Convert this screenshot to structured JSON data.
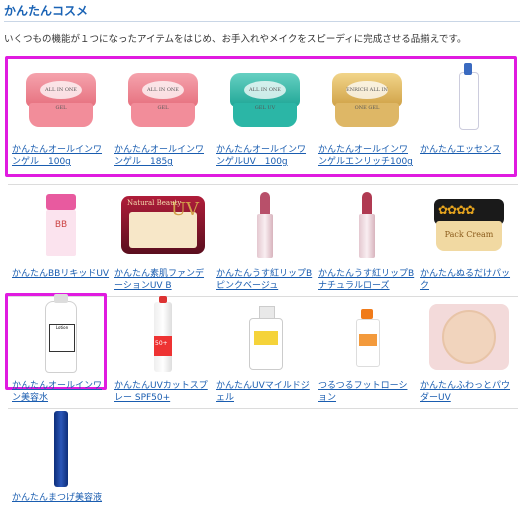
{
  "page": {
    "title": "かんたんコスメ",
    "description": "いくつもの機能が１つになったアイテムをはじめ、お手入れやメイクをスピーディに完成させる品揃えです。"
  },
  "colors": {
    "link": "#1a5db0",
    "title": "#1a63b5",
    "highlight": "#e01be0"
  },
  "rows": [
    {
      "items": [
        {
          "name": "かんたんオールインワンゲル　100g",
          "icon": "pink-jar-icon",
          "label": "ALL IN ONE GEL"
        },
        {
          "name": "かんたんオールインワンゲル　185g",
          "icon": "pink-jar-icon",
          "label": "ALL IN ONE GEL"
        },
        {
          "name": "かんたんオールインワンゲルUV　100g",
          "icon": "teal-jar-icon",
          "label": "ALL IN ONE GEL UV"
        },
        {
          "name": "かんたんオールインワンゲルエンリッチ100g",
          "icon": "gold-jar-icon",
          "label": "ENRICH ALL IN ONE GEL"
        },
        {
          "name": "かんたんエッセンス",
          "icon": "essence-bottle-icon"
        }
      ]
    },
    {
      "items": [
        {
          "name": "かんたんBBリキッドUV",
          "icon": "bb-liquid-icon",
          "label": "BB"
        },
        {
          "name": "かんたん素肌ファンデーションUV B",
          "icon": "foundation-compact-icon",
          "label": "Natural Beauty",
          "sub": "UV"
        },
        {
          "name": "かんたんうす紅リップB ピンクベージュ",
          "icon": "lipstick-icon",
          "color": "#b8506a"
        },
        {
          "name": "かんたんうす紅リップB ナチュラルローズ",
          "icon": "lipstick-icon",
          "color": "#b03a52"
        },
        {
          "name": "かんたんぬるだけパック",
          "icon": "pack-cream-jar-icon",
          "label": "Pack Cream"
        }
      ]
    },
    {
      "items": [
        {
          "name": "かんたんオールインワン美容水",
          "icon": "lotion-bottle-icon",
          "label": "Lotion"
        },
        {
          "name": "かんたんUVカットスプレー SPF50+",
          "icon": "uv-spray-icon",
          "label": "50+"
        },
        {
          "name": "かんたんUVマイルドジェル",
          "icon": "uv-gel-pump-icon"
        },
        {
          "name": "つるつるフットローション",
          "icon": "foot-lotion-icon"
        },
        {
          "name": "かんたんふわっとパウダーUV",
          "icon": "powder-compact-icon"
        }
      ]
    },
    {
      "items": [
        {
          "name": "かんたんまつげ美容液",
          "icon": "mascara-serum-icon"
        }
      ]
    }
  ]
}
